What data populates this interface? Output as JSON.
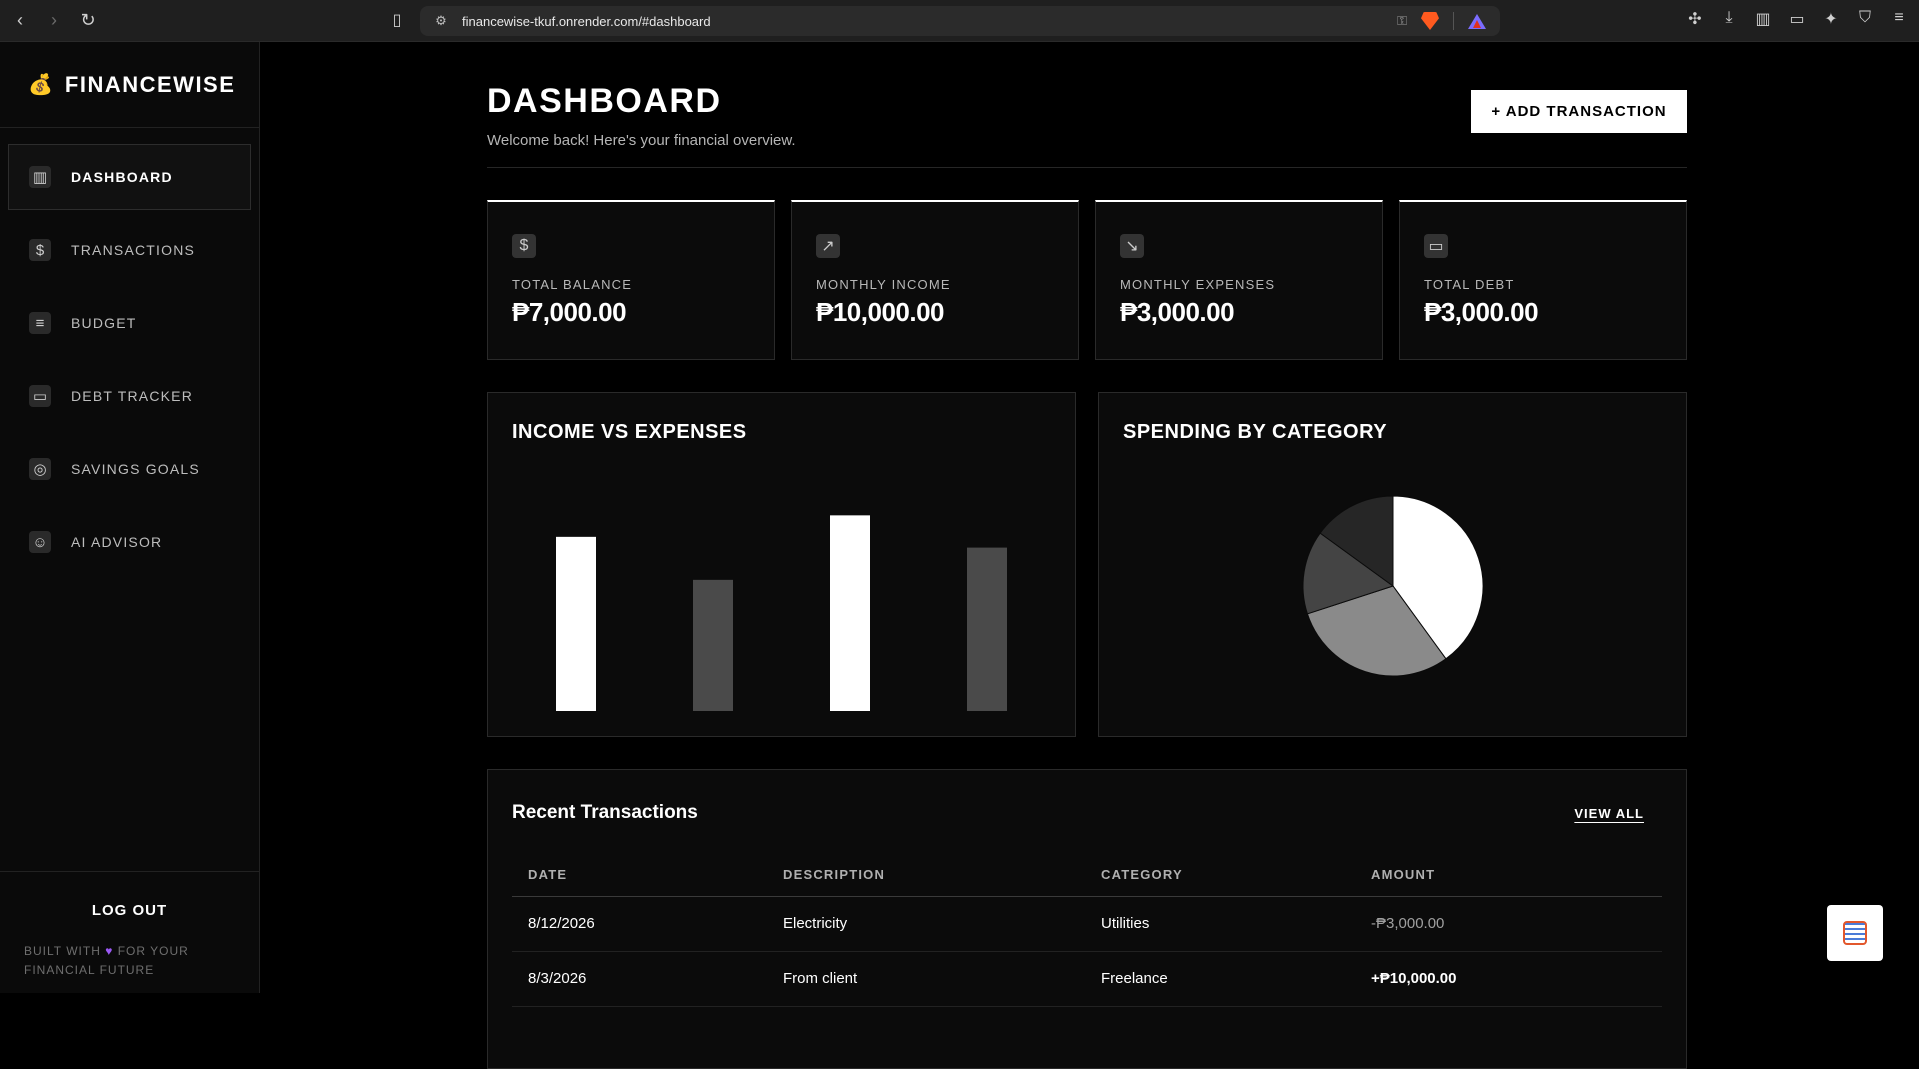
{
  "browser": {
    "url": "financewise-tkuf.onrender.com/#dashboard"
  },
  "sidebar": {
    "brand": "FINANCEWISE",
    "items": [
      {
        "label": "DASHBOARD",
        "icon": "building-icon",
        "active": true
      },
      {
        "label": "TRANSACTIONS",
        "icon": "money-bag-icon",
        "active": false
      },
      {
        "label": "BUDGET",
        "icon": "receipt-icon",
        "active": false
      },
      {
        "label": "DEBT TRACKER",
        "icon": "credit-card-icon",
        "active": false
      },
      {
        "label": "SAVINGS GOALS",
        "icon": "target-icon",
        "active": false
      },
      {
        "label": "AI ADVISOR",
        "icon": "robot-icon",
        "active": false
      }
    ],
    "logout": "LOG OUT",
    "built_prefix": "BUILT WITH",
    "built_suffix": "FOR YOUR FINANCIAL FUTURE"
  },
  "header": {
    "title": "DASHBOARD",
    "subtitle": "Welcome back! Here's your financial overview.",
    "add_button": "+ ADD TRANSACTION"
  },
  "stats": [
    {
      "label": "TOTAL BALANCE",
      "value": "₱7,000.00",
      "icon": "money-bag-icon"
    },
    {
      "label": "MONTHLY INCOME",
      "value": "₱10,000.00",
      "icon": "chart-up-icon"
    },
    {
      "label": "MONTHLY EXPENSES",
      "value": "₱3,000.00",
      "icon": "chart-down-icon"
    },
    {
      "label": "TOTAL DEBT",
      "value": "₱3,000.00",
      "icon": "credit-card-icon"
    }
  ],
  "charts": {
    "income_vs_expenses_title": "INCOME VS EXPENSES",
    "spending_title": "SPENDING BY CATEGORY"
  },
  "chart_data": [
    {
      "type": "bar",
      "title": "INCOME VS EXPENSES",
      "series": [
        {
          "values": [
            0.81,
            0.61,
            0.91,
            0.76
          ],
          "color": "#ffffff"
        }
      ],
      "bar_colors": [
        "#ffffff",
        "#4a4a4a",
        "#ffffff",
        "#4a4a4a"
      ],
      "ylim": [
        0,
        1
      ]
    },
    {
      "type": "pie",
      "title": "SPENDING BY CATEGORY",
      "values": [
        40,
        30,
        15,
        15
      ],
      "colors": [
        "#ffffff",
        "#8a8a8a",
        "#444444",
        "#262626"
      ]
    }
  ],
  "transactions": {
    "title": "Recent Transactions",
    "view_all": "VIEW ALL",
    "columns": [
      "DATE",
      "DESCRIPTION",
      "CATEGORY",
      "AMOUNT"
    ],
    "rows": [
      {
        "date": "8/12/2026",
        "description": "Electricity",
        "category": "Utilities",
        "amount": "-₱3,000.00",
        "type": "expense"
      },
      {
        "date": "8/3/2026",
        "description": "From client",
        "category": "Freelance",
        "amount": "+₱10,000.00",
        "type": "income"
      }
    ]
  }
}
